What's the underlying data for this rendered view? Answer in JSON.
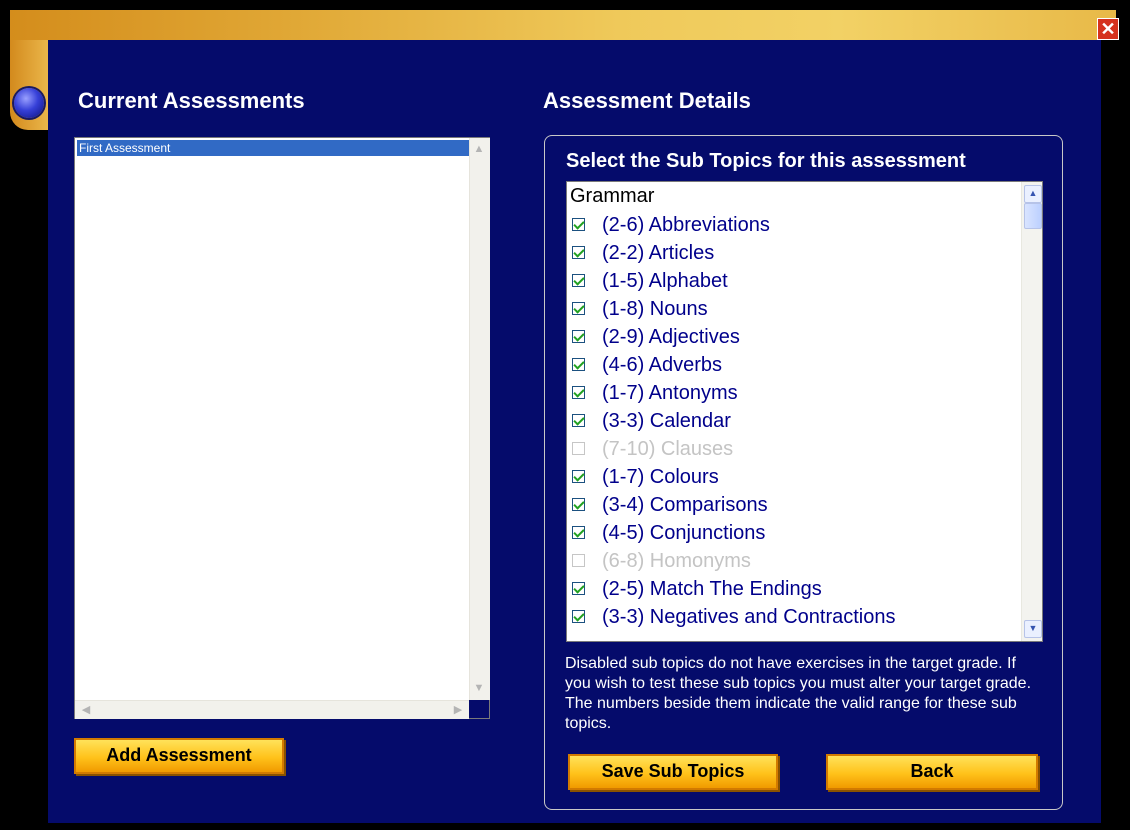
{
  "window": {
    "close_label": "✕"
  },
  "left": {
    "heading": "Current Assessments",
    "assessments": [
      "First Assessment"
    ],
    "add_button_label": "Add Assessment"
  },
  "right": {
    "heading": "Assessment Details",
    "subheading": "Select the Sub Topics for this assessment",
    "group": "Grammar",
    "topics": [
      {
        "label": "(2-6) Abbreviations",
        "checked": true,
        "enabled": true
      },
      {
        "label": "(2-2) Articles",
        "checked": true,
        "enabled": true
      },
      {
        "label": "(1-5) Alphabet",
        "checked": true,
        "enabled": true
      },
      {
        "label": "(1-8) Nouns",
        "checked": true,
        "enabled": true
      },
      {
        "label": "(2-9) Adjectives",
        "checked": true,
        "enabled": true
      },
      {
        "label": "(4-6) Adverbs",
        "checked": true,
        "enabled": true
      },
      {
        "label": "(1-7) Antonyms",
        "checked": true,
        "enabled": true
      },
      {
        "label": "(3-3) Calendar",
        "checked": true,
        "enabled": true
      },
      {
        "label": "(7-10) Clauses",
        "checked": false,
        "enabled": false
      },
      {
        "label": "(1-7) Colours",
        "checked": true,
        "enabled": true
      },
      {
        "label": "(3-4) Comparisons",
        "checked": true,
        "enabled": true
      },
      {
        "label": "(4-5) Conjunctions",
        "checked": true,
        "enabled": true
      },
      {
        "label": "(6-8) Homonyms",
        "checked": false,
        "enabled": false
      },
      {
        "label": "(2-5) Match The Endings",
        "checked": true,
        "enabled": true
      },
      {
        "label": "(3-3) Negatives and Contractions",
        "checked": true,
        "enabled": true
      }
    ],
    "note": "Disabled sub topics do not have exercises in the target grade. If you wish to test these sub topics you must alter your target grade. The numbers beside them indicate the valid range for these sub topics.",
    "save_button_label": "Save Sub Topics",
    "back_button_label": "Back"
  },
  "colors": {
    "background": "#050b6b",
    "selection": "#316ac5",
    "topic_text": "#00008b",
    "disabled_text": "#c4c4c4",
    "button_gold": "#ffc21a"
  }
}
